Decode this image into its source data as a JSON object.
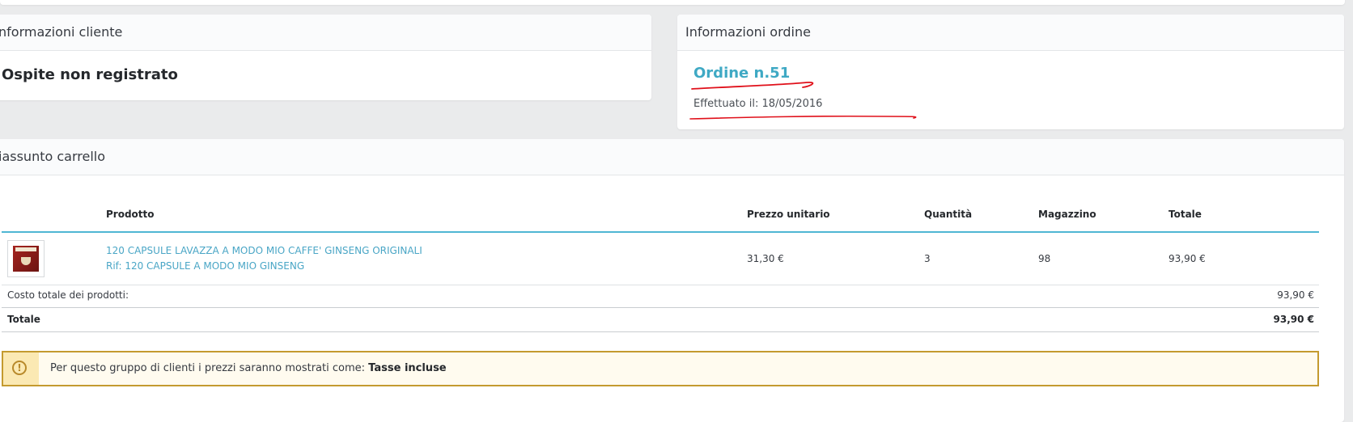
{
  "customer_panel": {
    "title": "nformazioni cliente",
    "guest_label": "Ospite non registrato"
  },
  "order_panel": {
    "title": "Informazioni ordine",
    "order_number": "Ordine n.51",
    "placed_on": "Effettuato il: 18/05/2016"
  },
  "cart_panel": {
    "title": "iassunto carrello",
    "columns": {
      "product": "Prodotto",
      "unit_price": "Prezzo unitario",
      "quantity": "Quantità",
      "stock": "Magazzino",
      "total": "Totale"
    },
    "rows": [
      {
        "name": "120 CAPSULE LAVAZZA A MODO MIO CAFFE' GINSENG ORIGINALI",
        "ref": "Rif: 120 CAPSULE A MODO MIO GINSENG",
        "unit_price": "31,30 €",
        "quantity": "3",
        "stock": "98",
        "total": "93,90 €"
      }
    ],
    "products_total_label": "Costo totale dei prodotti:",
    "products_total_value": "93,90 €",
    "grand_total_label": "Totale",
    "grand_total_value": "93,90 €"
  },
  "alert": {
    "icon": "warning-circle-icon",
    "text": "Per questo gruppo di clienti i prezzi saranno mostrati come: ",
    "emphasis": "Tasse incluse"
  },
  "colors": {
    "link": "#4aa6c6",
    "accent_line": "#4fb7d3",
    "alert_border": "#c49a2f",
    "annotation": "#e0101a"
  }
}
